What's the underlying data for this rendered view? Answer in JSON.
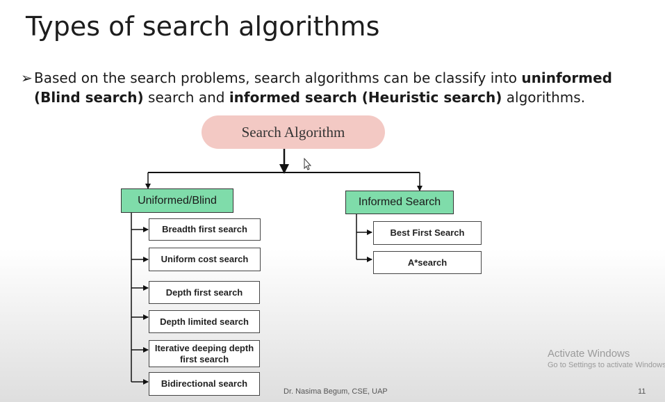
{
  "slide": {
    "title": "Types of search algorithms",
    "bullet": {
      "mark": "➢",
      "part1": "Based on the search problems, search algorithms can be classify into ",
      "bold1": "uninformed (Blind search)",
      "part2": " search and ",
      "bold2": "informed search (Heuristic search)",
      "part3": " algorithms."
    },
    "footer": "Dr. Nasima Begum, CSE, UAP",
    "page_number": "11"
  },
  "diagram": {
    "root": "Search Algorithm",
    "branches": [
      {
        "label": "Uniformed/Blind",
        "children": [
          "Breadth first search",
          "Uniform cost search",
          "Depth first search",
          "Depth limited search",
          "Iterative deeping depth first search",
          "Bidirectional search"
        ]
      },
      {
        "label": "Informed Search",
        "children": [
          "Best First Search",
          "A*search"
        ]
      }
    ]
  },
  "watermark": {
    "line1": "Activate Windows",
    "line2": "Go to Settings to activate Windows."
  }
}
